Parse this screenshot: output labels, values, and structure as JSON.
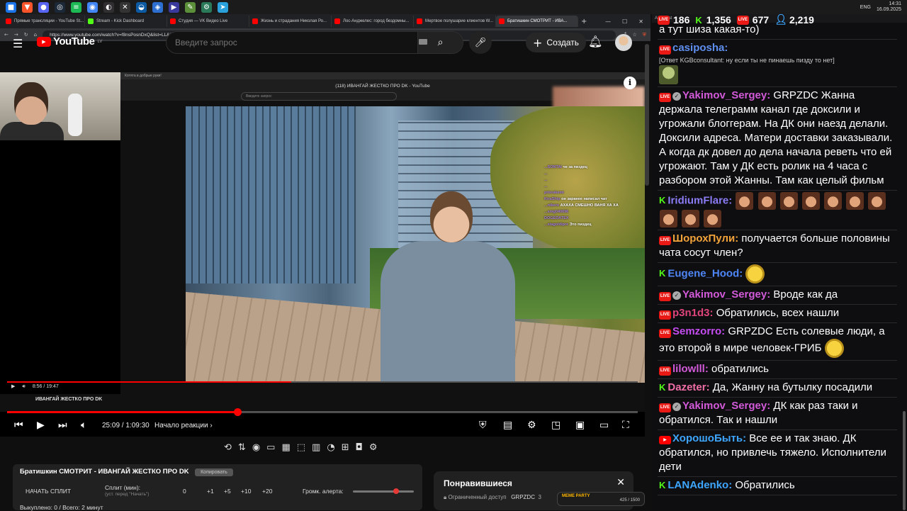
{
  "taskbar": {
    "icons": [
      {
        "name": "start-icon",
        "color": "#1a73e8",
        "glyph": "■"
      },
      {
        "name": "brave-icon",
        "color": "#fb542b",
        "glyph": "▼"
      },
      {
        "name": "discord-icon",
        "color": "#5865f2",
        "glyph": "●"
      },
      {
        "name": "steam-icon",
        "color": "#1b2838",
        "glyph": "◎"
      },
      {
        "name": "spotify-icon",
        "color": "#1db954",
        "glyph": "≡"
      },
      {
        "name": "chrome-icon",
        "color": "#4285f4",
        "glyph": "◉"
      },
      {
        "name": "obs-icon",
        "color": "#302e31",
        "glyph": "◐"
      },
      {
        "name": "app-icon",
        "color": "#333333",
        "glyph": "✕"
      },
      {
        "name": "edge-icon",
        "color": "#0c59a4",
        "glyph": "◒"
      },
      {
        "name": "vpn-icon",
        "color": "#2c6fd1",
        "glyph": "◈"
      },
      {
        "name": "player-icon",
        "color": "#3a3a9e",
        "glyph": "▶"
      },
      {
        "name": "tool-icon",
        "color": "#5b8f3a",
        "glyph": "✎"
      },
      {
        "name": "settings-icon",
        "color": "#2a7a5a",
        "glyph": "⚙"
      },
      {
        "name": "telegram-icon",
        "color": "#2aa1da",
        "glyph": "➤"
      }
    ],
    "lang": "ENG",
    "time": "14:31",
    "date": "16.09.2025"
  },
  "browser": {
    "tabs": [
      {
        "label": "Прямые трансляции - YouTube St...",
        "color": "#ff0000"
      },
      {
        "label": "Stream - Kick Dashboard",
        "color": "#53fc18"
      },
      {
        "label": "Студия — VK Видео Live",
        "color": "#ff0000"
      },
      {
        "label": "Жизнь и страдания Николая Ро...",
        "color": "#ff0000"
      },
      {
        "label": "Лос-Анджелес: город бездомны...",
        "color": "#ff0000"
      },
      {
        "label": "Мертвое полушарие клиентов W...",
        "color": "#ff0000"
      },
      {
        "label": "Братишкин СМОТРИТ - ИВА...",
        "color": "#ff0000"
      }
    ],
    "url": "https://www.youtube.com/watch?v=f8nsPosnDxQ&list=LL&index=4&t=1s"
  },
  "youtube": {
    "logo_text": "YouTube",
    "logo_region": "LV",
    "search_placeholder": "Введите запрос",
    "create_label": "Создать",
    "video": {
      "inner_tab": "Котята в добрые руки!",
      "inner_title": "(118) ИВАНГАЙ ЖЕСТКО ПРО DK - YouTube",
      "inner_search": "Введите запрос",
      "inner_time": "8:56 / 19:47",
      "under_title": "ИВАНГАЙ ЖЕСТКО ПРО DK",
      "inner_progress_pct": 45
    },
    "player": {
      "time": "25:09 / 1:09:30",
      "chapter": "Начало реакции",
      "progress_pct": 36.5
    },
    "overlay_chat": [
      {
        "user": "...SONTAl",
        "text": "че за пиздец"
      },
      {
        "user": "...",
        "text": ""
      },
      {
        "user": "...",
        "text": ""
      },
      {
        "user": "...",
        "text": ""
      },
      {
        "user": "prisrakemi",
        "text": ""
      },
      {
        "user": "KiraShip",
        "text": "он заранее написал чат"
      },
      {
        "user": "...nikero",
        "text": "АХАХА СМЕШНО ВАНЯ ХА ХА"
      },
      {
        "user": "...snig040696",
        "text": ""
      },
      {
        "user": "DOGEDATEX",
        "text": ""
      },
      {
        "user": "...stagoldipre",
        "text": "Это пиздец"
      }
    ]
  },
  "extension": {
    "title": "Братишкин СМОТРИТ - ИВАНГАЙ ЖЕСТКО ПРО DK",
    "copy_label": "Копировать",
    "split_button": "НАЧАТЬ СПЛИТ",
    "split_label": "Сплит (мин):",
    "split_hint": "(уст. перед \"Начать\")",
    "split_value": "0",
    "increments": [
      "+1",
      "+5",
      "+10",
      "+20"
    ],
    "volume_label": "Громк. алерта:",
    "volume_pct": 20,
    "stats": "Выкуплено: 0 / Всего: 2 минут"
  },
  "liked": {
    "heading": "Понравившиеся",
    "access": "Ограниченный доступ",
    "channel": "GRPZDC",
    "count": "3",
    "party_title": "MEME PARTY",
    "party_progress": "425 / 1500"
  },
  "chat": {
    "header": "AxelChat",
    "counts": [
      {
        "platform": "live",
        "value": "186"
      },
      {
        "platform": "kick",
        "value": "1,356"
      },
      {
        "platform": "live",
        "value": "677"
      },
      {
        "platform": "viewers",
        "value": "2,219"
      }
    ],
    "messages": [
      {
        "platform": "",
        "verified": false,
        "user": "",
        "color": "#ffffff",
        "text": "а тут шиза какая-то)",
        "reply": "",
        "emotes": []
      },
      {
        "platform": "live",
        "verified": false,
        "user": "casiposha:",
        "color": "#5f8ff0",
        "text": "",
        "reply": "[Ответ KGBconsultant: ну если ты не пинаешь пизду то нет]",
        "emotes": [
          "green"
        ]
      },
      {
        "platform": "live",
        "verified": true,
        "user": "Yakimov_Sergey:",
        "color": "#d25ad8",
        "text": "GRPZDC Жанна держала телеграмм канал где доксили и угрожали блоггерам. На ДК они наезд делали. Доксили адреса. Матери доставки заказывали. А когда дк довел до дела начала реветь что ей угрожают. Там у ДК есть ролик на 4 часа с разбором этой Жанны. Там как целый фильм",
        "reply": "",
        "emotes": []
      },
      {
        "platform": "kick",
        "verified": false,
        "user": "IridiumFlare:",
        "color": "#8a7cf5",
        "text": "",
        "reply": "",
        "emotes": [
          "f",
          "f",
          "f",
          "f",
          "f",
          "f",
          "f",
          "f",
          "f",
          "f"
        ]
      },
      {
        "platform": "live",
        "verified": false,
        "user": "ШорохПули:",
        "color": "#f2a33a",
        "text": "получается больше половины чата сосут член?",
        "reply": "",
        "emotes": []
      },
      {
        "platform": "kick",
        "verified": false,
        "user": "Eugene_Hood:",
        "color": "#4f86f7",
        "text": "",
        "reply": "",
        "emotes": [
          "yellow"
        ]
      },
      {
        "platform": "live",
        "verified": true,
        "user": "Yakimov_Sergey:",
        "color": "#d25ad8",
        "text": "Вроде как да",
        "reply": "",
        "emotes": []
      },
      {
        "platform": "live",
        "verified": false,
        "user": "p3n1d3:",
        "color": "#e0457a",
        "text": "Обратились, всех нашли",
        "reply": "",
        "emotes": []
      },
      {
        "platform": "live",
        "verified": false,
        "user": "Semzorro:",
        "color": "#c44cf0",
        "text": "GRPZDC Есть солевые люди, а это второй в мире человек-ГРИБ",
        "reply": "",
        "emotes": [
          "yellow"
        ]
      },
      {
        "platform": "live",
        "verified": false,
        "user": "lilowlll:",
        "color": "#d25ad8",
        "text": "обратились",
        "reply": "",
        "emotes": []
      },
      {
        "platform": "kick",
        "verified": false,
        "user": "Dazeter:",
        "color": "#f06ea6",
        "text": "Да, Жанну на бутылку посадили",
        "reply": "",
        "emotes": []
      },
      {
        "platform": "live",
        "verified": true,
        "user": "Yakimov_Sergey:",
        "color": "#d25ad8",
        "text": "ДК как раз таки и обратился. Так и нашли",
        "reply": "",
        "emotes": []
      },
      {
        "platform": "yt",
        "verified": false,
        "user": "ХорошоБыть:",
        "color": "#3ea6ff",
        "text": "Все ее и так знаю. ДК обратился, но привлечь тяжело. Исполнители дети",
        "reply": "",
        "emotes": []
      },
      {
        "platform": "kick",
        "verified": false,
        "user": "LANAdenko:",
        "color": "#3ea6ff",
        "text": "Обратились",
        "reply": "",
        "emotes": []
      }
    ]
  }
}
